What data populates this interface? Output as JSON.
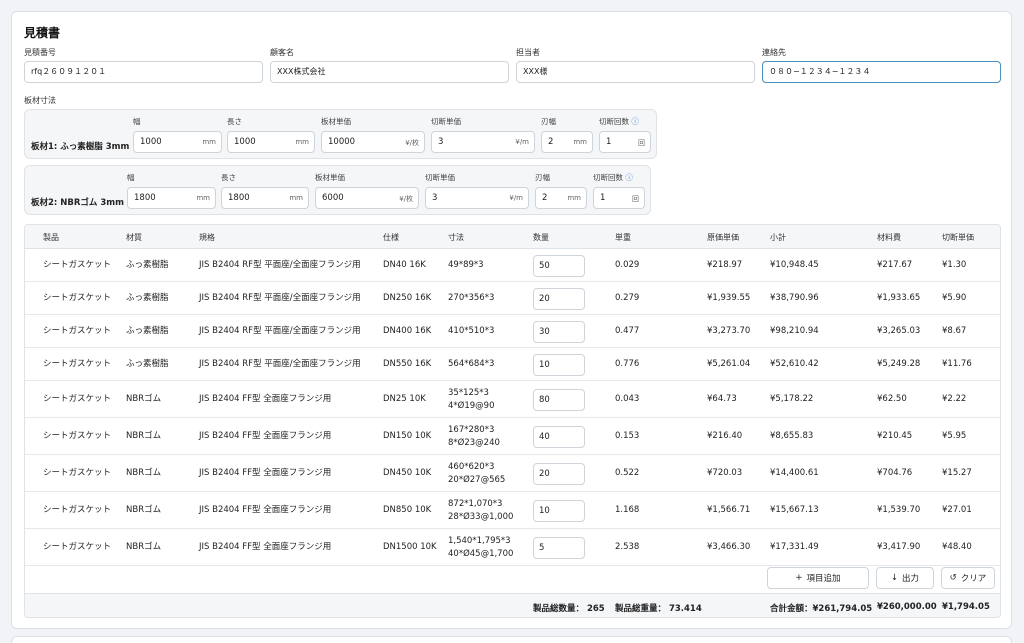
{
  "header": {
    "title": "見積書"
  },
  "fields": [
    {
      "label": "見積番号",
      "value": "rfq２６０９１２０１"
    },
    {
      "label": "顧客名",
      "value": "XXX株式会社"
    },
    {
      "label": "担当者",
      "value": "XXX様"
    },
    {
      "label": "連絡先",
      "value": "０８０−１２３４−１２３４"
    }
  ],
  "plate_section": {
    "label": "板材寸法"
  },
  "plate_labels": {
    "width": "幅",
    "length": "長さ",
    "unit_price": "板材単価",
    "cut_price": "切断単価",
    "blade": "刃幅",
    "cut_count": "切断回数",
    "info_icon": "ⓘ"
  },
  "plate_units": {
    "width": "mm",
    "length": "mm",
    "unit_price": "¥/枚",
    "cut_price": "¥/m",
    "blade": "mm",
    "cut_count": "回"
  },
  "plates": [
    {
      "name": "板材1: ふっ素樹脂 3mm",
      "width": "1000",
      "length": "1000",
      "unit_price": "10000",
      "cut_price": "3",
      "blade": "2",
      "cut_count": "1"
    },
    {
      "name": "板材2: NBRゴム 3mm",
      "width": "1800",
      "length": "1800",
      "unit_price": "6000",
      "cut_price": "3",
      "blade": "2",
      "cut_count": "1"
    }
  ],
  "table": {
    "headers": [
      "製品",
      "材質",
      "規格",
      "仕様",
      "寸法",
      "数量",
      "単重",
      "原価単価",
      "小計",
      "材料費",
      "切断単価"
    ],
    "rows": [
      {
        "product": "シートガスケット",
        "material": "ふっ素樹脂",
        "standard": "JIS B2404 RF型 平面座/全面座フランジ用",
        "spec": "DN40 16K",
        "dim1": "49*89*3",
        "dim2": "",
        "qty": "50",
        "weight": "0.029",
        "cost": "¥218.97",
        "subtotal": "¥10,948.45",
        "material_cost": "¥217.67",
        "cut_cost": "¥1.30"
      },
      {
        "product": "シートガスケット",
        "material": "ふっ素樹脂",
        "standard": "JIS B2404 RF型 平面座/全面座フランジ用",
        "spec": "DN250 16K",
        "dim1": "270*356*3",
        "dim2": "",
        "qty": "20",
        "weight": "0.279",
        "cost": "¥1,939.55",
        "subtotal": "¥38,790.96",
        "material_cost": "¥1,933.65",
        "cut_cost": "¥5.90"
      },
      {
        "product": "シートガスケット",
        "material": "ふっ素樹脂",
        "standard": "JIS B2404 RF型 平面座/全面座フランジ用",
        "spec": "DN400 16K",
        "dim1": "410*510*3",
        "dim2": "",
        "qty": "30",
        "weight": "0.477",
        "cost": "¥3,273.70",
        "subtotal": "¥98,210.94",
        "material_cost": "¥3,265.03",
        "cut_cost": "¥8.67"
      },
      {
        "product": "シートガスケット",
        "material": "ふっ素樹脂",
        "standard": "JIS B2404 RF型 平面座/全面座フランジ用",
        "spec": "DN550 16K",
        "dim1": "564*684*3",
        "dim2": "",
        "qty": "10",
        "weight": "0.776",
        "cost": "¥5,261.04",
        "subtotal": "¥52,610.42",
        "material_cost": "¥5,249.28",
        "cut_cost": "¥11.76"
      },
      {
        "product": "シートガスケット",
        "material": "NBRゴム",
        "standard": "JIS B2404 FF型 全面座フランジ用",
        "spec": "DN25 10K",
        "dim1": "35*125*3",
        "dim2": "4*Ø19@90",
        "qty": "80",
        "weight": "0.043",
        "cost": "¥64.73",
        "subtotal": "¥5,178.22",
        "material_cost": "¥62.50",
        "cut_cost": "¥2.22"
      },
      {
        "product": "シートガスケット",
        "material": "NBRゴム",
        "standard": "JIS B2404 FF型 全面座フランジ用",
        "spec": "DN150 10K",
        "dim1": "167*280*3",
        "dim2": "8*Ø23@240",
        "qty": "40",
        "weight": "0.153",
        "cost": "¥216.40",
        "subtotal": "¥8,655.83",
        "material_cost": "¥210.45",
        "cut_cost": "¥5.95"
      },
      {
        "product": "シートガスケット",
        "material": "NBRゴム",
        "standard": "JIS B2404 FF型 全面座フランジ用",
        "spec": "DN450 10K",
        "dim1": "460*620*3",
        "dim2": "20*Ø27@565",
        "qty": "20",
        "weight": "0.522",
        "cost": "¥720.03",
        "subtotal": "¥14,400.61",
        "material_cost": "¥704.76",
        "cut_cost": "¥15.27"
      },
      {
        "product": "シートガスケット",
        "material": "NBRゴム",
        "standard": "JIS B2404 FF型 全面座フランジ用",
        "spec": "DN850 10K",
        "dim1": "872*1,070*3",
        "dim2": "28*Ø33@1,000",
        "qty": "10",
        "weight": "1.168",
        "cost": "¥1,566.71",
        "subtotal": "¥15,667.13",
        "material_cost": "¥1,539.70",
        "cut_cost": "¥27.01"
      },
      {
        "product": "シートガスケット",
        "material": "NBRゴム",
        "standard": "JIS B2404 FF型 全面座フランジ用",
        "spec": "DN1500 10K",
        "dim1": "1,540*1,795*3",
        "dim2": "40*Ø45@1,700",
        "qty": "5",
        "weight": "2.538",
        "cost": "¥3,466.30",
        "subtotal": "¥17,331.49",
        "material_cost": "¥3,417.90",
        "cut_cost": "¥48.40"
      }
    ]
  },
  "buttons": {
    "add": {
      "icon": "+",
      "label": "項目追加"
    },
    "export": {
      "icon": "↓",
      "label": "出力"
    },
    "clear": {
      "icon": "↺",
      "label": "クリア"
    }
  },
  "totals": {
    "qty": "製品総数量： 265",
    "weight": "製品総重量： 73.414",
    "amount": "合計金額：¥261,794.05",
    "material": "¥260,000.00",
    "cut": "¥1,794.05"
  }
}
